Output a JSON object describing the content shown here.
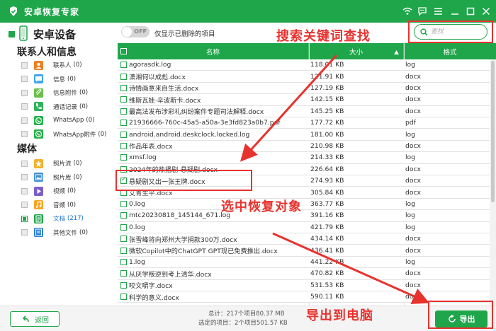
{
  "app": {
    "title": "安卓恢复专家"
  },
  "device": {
    "title": "安卓设备"
  },
  "sections": {
    "contacts_info": "联系人和信息",
    "media": "媒体"
  },
  "sidebar": {
    "contacts_items": [
      {
        "label": "联系人",
        "count": "(0)",
        "icon": "contacts-icon",
        "color": "#f07f22"
      },
      {
        "label": "信息",
        "count": "(0)",
        "icon": "message-icon",
        "color": "#3fa7e8"
      },
      {
        "label": "信息附件",
        "count": "(0)",
        "icon": "attachment-icon",
        "color": "#6cc04a"
      },
      {
        "label": "通话记录",
        "count": "(0)",
        "icon": "phone-icon",
        "color": "#2fb35a"
      },
      {
        "label": "WhatsApp",
        "count": "(0)",
        "icon": "whatsapp-icon",
        "color": "#25b34b"
      },
      {
        "label": "WhatsApp附件",
        "count": "(0)",
        "icon": "whatsapp-attachment-icon",
        "color": "#25b34b"
      }
    ],
    "media_items": [
      {
        "label": "照片流",
        "count": "(0)",
        "icon": "photo-stream-icon",
        "color": "#f3b12a"
      },
      {
        "label": "照片库",
        "count": "(0)",
        "icon": "photo-library-icon",
        "color": "#3d8fd6"
      },
      {
        "label": "视频",
        "count": "(0)",
        "icon": "video-icon",
        "color": "#7a5fc8"
      },
      {
        "label": "音频",
        "count": "(0)",
        "icon": "audio-icon",
        "color": "#f5a623"
      },
      {
        "label": "文档",
        "count": "(217)",
        "icon": "document-icon",
        "color": "#1fa64a",
        "active": true
      },
      {
        "label": "其他文件",
        "count": "(0)",
        "icon": "other-files-icon",
        "color": "#2b7fd1"
      }
    ]
  },
  "filter": {
    "toggle_text": "OFF",
    "label": "仅显示已删除的项目"
  },
  "search": {
    "placeholder": "查找"
  },
  "table": {
    "headers": {
      "name": "名称",
      "size": "大小",
      "format": "格式"
    },
    "rows": [
      {
        "name": "agorasdk.log",
        "size": "118.01 KB",
        "format": "log",
        "checked": false
      },
      {
        "name": "潇湘何以成彪.docx",
        "size": "121.91 KB",
        "format": "docx",
        "checked": false
      },
      {
        "name": "诗情画意来自生活.docx",
        "size": "127.19 KB",
        "format": "docx",
        "checked": false
      },
      {
        "name": "维斯瓦娃·辛波斯卡.docx",
        "size": "142.15 KB",
        "format": "docx",
        "checked": false
      },
      {
        "name": "最高法发布涉彩礼纠纷案件专题司法解释.docx",
        "size": "145.25 KB",
        "format": "docx",
        "checked": false
      },
      {
        "name": "21936666-760c-45a5-a50a-3e3fd823a0b7.pdf",
        "size": "177.72 KB",
        "format": "pdf",
        "checked": false
      },
      {
        "name": "android.android.deskclock.locked.log",
        "size": "181.00 KB",
        "format": "log",
        "checked": false
      },
      {
        "name": "作品年表.docx",
        "size": "210.98 KB",
        "format": "docx",
        "checked": false
      },
      {
        "name": "xmsf.log",
        "size": "214.33 KB",
        "format": "log",
        "checked": false
      },
      {
        "name": "2024年的热播剧-悬疑剧.docx",
        "size": "226.64 KB",
        "format": "docx",
        "checked": false
      },
      {
        "name": "悬疑剧又出一张王牌.docx",
        "size": "274.93 KB",
        "format": "docx",
        "checked": true
      },
      {
        "name": "艾青生平.docx",
        "size": "305.84 KB",
        "format": "docx",
        "checked": false
      },
      {
        "name": "0.log",
        "size": "363.77 KB",
        "format": "log",
        "checked": false
      },
      {
        "name": "mtc20230818_145144_671.log",
        "size": "391.16 KB",
        "format": "log",
        "checked": false
      },
      {
        "name": "0.log",
        "size": "421.79 KB",
        "format": "log",
        "checked": false
      },
      {
        "name": "张雪峰将向郑州大学捐款300万.docx",
        "size": "434.14 KB",
        "format": "docx",
        "checked": false
      },
      {
        "name": "微软Copilot中的ChatGPT GPT现已免费推出.docx",
        "size": "436.41 KB",
        "format": "docx",
        "checked": false
      },
      {
        "name": "1.log",
        "size": "441.22 KB",
        "format": "log",
        "checked": false
      },
      {
        "name": "从厌学叛逆到考上清华.docx",
        "size": "470.82 KB",
        "format": "docx",
        "checked": false
      },
      {
        "name": "咬文嚼字.docx",
        "size": "531.53 KB",
        "format": "docx",
        "checked": false
      },
      {
        "name": "科学的意义.docx",
        "size": "590.11 KB",
        "format": "docx",
        "checked": false
      }
    ]
  },
  "annotations": {
    "search": "搜索关键词查找",
    "select": "选中恢复对象",
    "export": "导出到电脑"
  },
  "bottom": {
    "back_label": "返回",
    "total": "总计：217个项目80.37 MB",
    "selected": "选定的项目：2个项目501.57 KB",
    "export_label": "导出"
  },
  "colors": {
    "brand": "#1fa64a",
    "annotation": "#e8322e"
  }
}
